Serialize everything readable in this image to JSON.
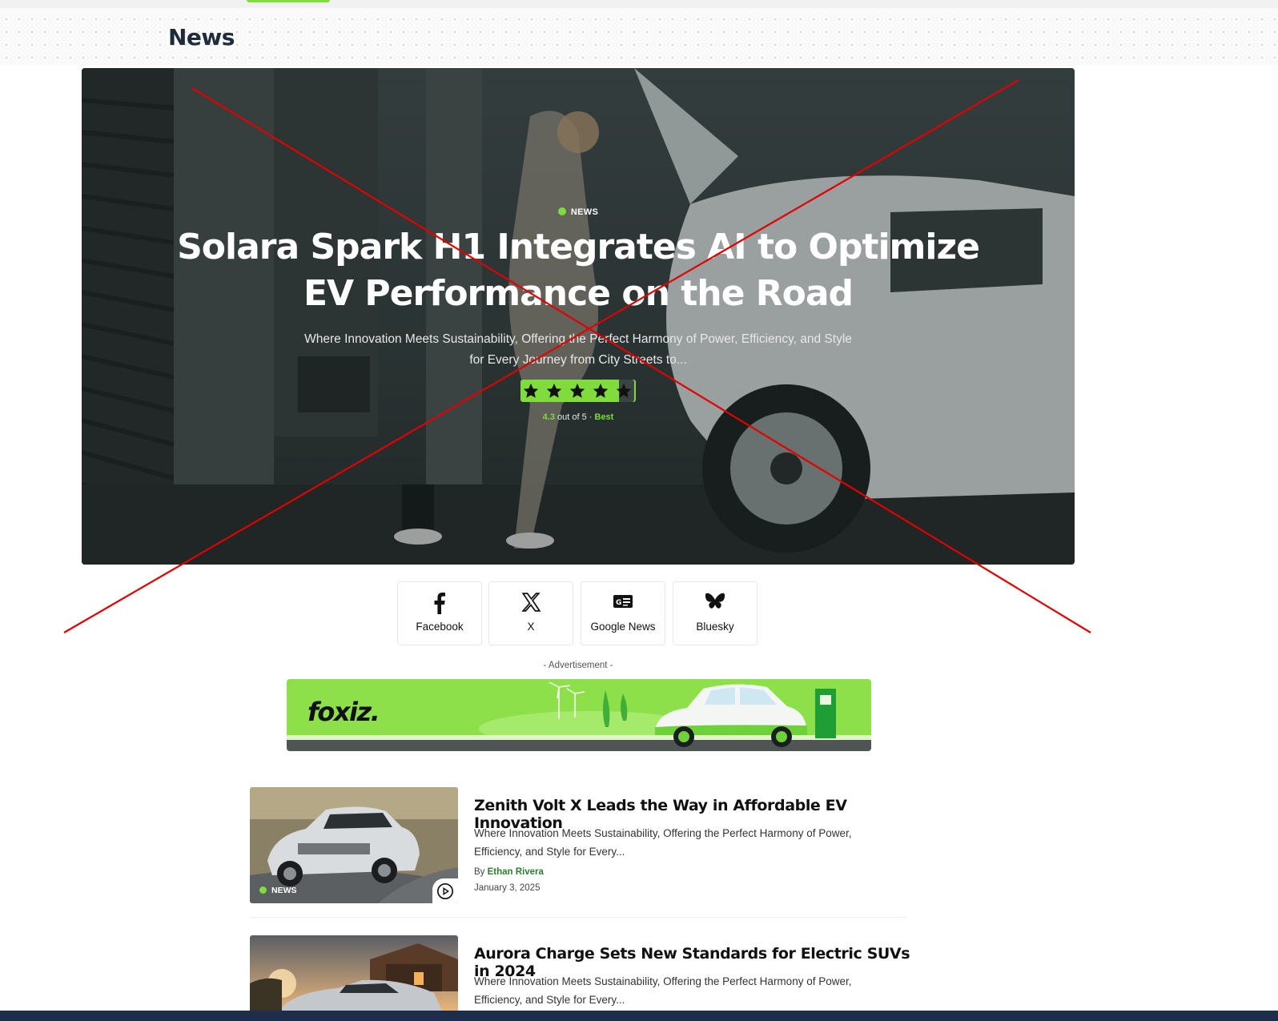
{
  "page": {
    "title": "News"
  },
  "hero": {
    "category": "NEWS",
    "title": "Solara Spark H1 Integrates AI to Optimize EV Performance on the Road",
    "excerpt": "Where Innovation Meets Sustainability, Offering the Perfect Harmony of Power, Efficiency, and Style for Every Journey from City Streets to...",
    "rating_value": "4.3",
    "rating_suffix": "out of 5 ·",
    "rating_label": "Best",
    "stars": 4.3
  },
  "share": [
    {
      "label": "Facebook",
      "icon": "facebook-icon"
    },
    {
      "label": "X",
      "icon": "x-icon"
    },
    {
      "label": "Google News",
      "icon": "google-news-icon"
    },
    {
      "label": "Bluesky",
      "icon": "bluesky-icon"
    }
  ],
  "ad": {
    "label": "- Advertisement -",
    "brand": "foxiz."
  },
  "posts": [
    {
      "title": "Zenith Volt X Leads the Way in Affordable EV Innovation",
      "excerpt": "Where Innovation Meets Sustainability, Offering the Perfect Harmony of Power, Efficiency, and Style for Every...",
      "by": "By",
      "author": "Ethan Rivera",
      "date": "January 3, 2025",
      "category": "NEWS"
    },
    {
      "title": "Aurora Charge Sets New Standards for Electric SUVs in 2024",
      "excerpt": "Where Innovation Meets Sustainability, Offering the Perfect Harmony of Power, Efficiency, and Style for Every..."
    }
  ],
  "colors": {
    "accent": "#7fdc3c",
    "author": "#2e7d32",
    "cross": "#e10000"
  }
}
